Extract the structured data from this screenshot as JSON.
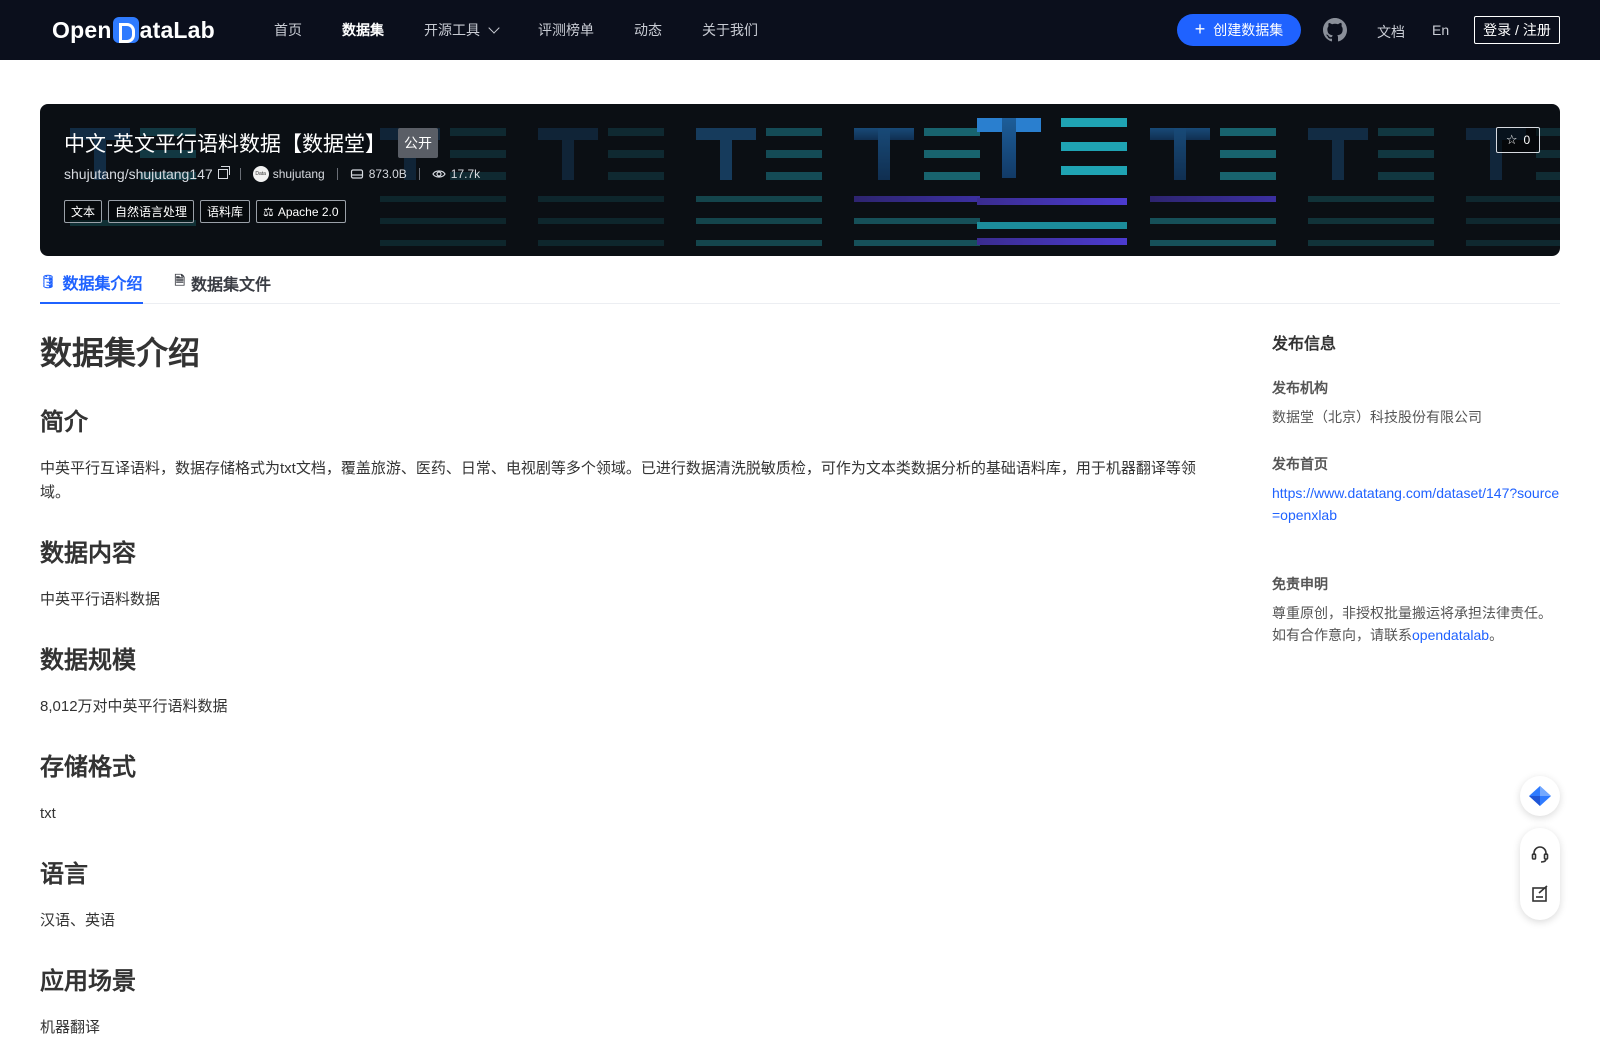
{
  "header": {
    "logo_text_left": "Open",
    "logo_text_right": "ataLab",
    "nav": [
      {
        "label": "首页"
      },
      {
        "label": "数据集"
      },
      {
        "label": "开源工具"
      },
      {
        "label": "评测榜单"
      },
      {
        "label": "动态"
      },
      {
        "label": "关于我们"
      }
    ],
    "create_label": "创建数据集",
    "docs_label": "文档",
    "lang_label": "En",
    "login_label": "登录 / 注册"
  },
  "banner": {
    "title": "中文-英文平行语料数据【数据堂】",
    "visibility": "公开",
    "repo": "shujutang/shujutang147",
    "avatar_text": "Data",
    "owner": "shujutang",
    "size": "873.0B",
    "views": "17.7k",
    "tags": [
      "文本",
      "自然语言处理",
      "语料库"
    ],
    "license": "Apache 2.0",
    "stars": "0"
  },
  "tabs": [
    {
      "label": "数据集介绍"
    },
    {
      "label": "数据集文件"
    }
  ],
  "content": {
    "page_title": "数据集介绍",
    "sections": [
      {
        "heading": "简介",
        "body": "中英平行互译语料，数据存储格式为txt文档，覆盖旅游、医药、日常、电视剧等多个领域。已进行数据清洗脱敏质检，可作为文本类数据分析的基础语料库，用于机器翻译等领域。"
      },
      {
        "heading": "数据内容",
        "body": "中英平行语料数据"
      },
      {
        "heading": "数据规模",
        "body": "8,012万对中英平行语料数据"
      },
      {
        "heading": "存储格式",
        "body": "txt"
      },
      {
        "heading": "语言",
        "body": "汉语、英语"
      },
      {
        "heading": "应用场景",
        "body": "机器翻译"
      }
    ]
  },
  "sidebar": {
    "title": "发布信息",
    "org_label": "发布机构",
    "org_value": "数据堂（北京）科技股份有限公司",
    "homepage_label": "发布首页",
    "homepage_url": "https://www.datatang.com/dataset/147?source=openxlab",
    "disclaimer_label": "免责申明",
    "disclaimer_text1": "尊重原创，非授权批量搬运将承担法律责任。",
    "disclaimer_text2": "如有合作意向，请联系",
    "disclaimer_link": "opendatalab",
    "disclaimer_end": "。"
  },
  "colors": {
    "accent": "#1f62ff",
    "header_bg": "#0b0f1c",
    "banner_bg": "#0b0f14"
  }
}
